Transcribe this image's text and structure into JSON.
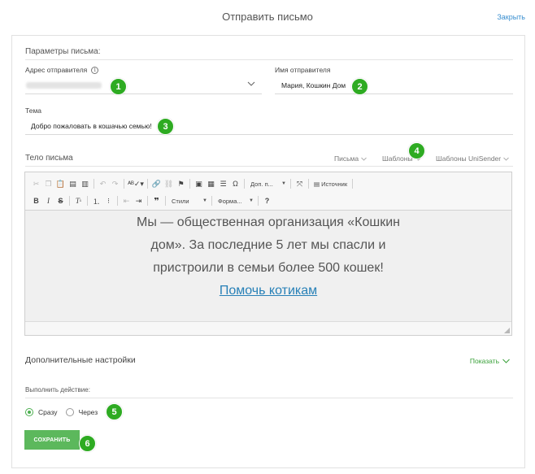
{
  "header": {
    "title": "Отправить письмо",
    "close_label": "Закрыть"
  },
  "params": {
    "section_title": "Параметры письма:",
    "sender_address_label": "Адрес отправителя",
    "info_icon_glyph": "i",
    "sender_name_label": "Имя отправителя",
    "sender_name_value": "Мария, Кошкин Дом",
    "subject_label": "Тема",
    "subject_value": "Добро пожаловать в кошачью семью!"
  },
  "body_section": {
    "title": "Тело письма",
    "tabs": [
      {
        "label": "Письма"
      },
      {
        "label": "Шаблоны"
      },
      {
        "label": "Шаблоны UniSender"
      }
    ]
  },
  "toolbar": {
    "row1_combo": "Доп. п...",
    "source_label": "Источник",
    "styles_combo": "Стили",
    "format_combo": "Форма...",
    "help_glyph": "?"
  },
  "content": {
    "line1": "Мы — общественная организация «Кошкин",
    "line2": "дом». За последние 5 лет мы спасли и",
    "line3": "пристроили в семьи более 500 кошек!",
    "link": "Помочь котикам"
  },
  "advanced": {
    "title": "Дополнительные настройки",
    "show_label": "Показать"
  },
  "action": {
    "label": "Выполнить действие:",
    "options": [
      {
        "label": "Сразу",
        "checked": true
      },
      {
        "label": "Через",
        "checked": false
      }
    ]
  },
  "save_label": "СОХРАНИТЬ",
  "badges": [
    "1",
    "2",
    "3",
    "4",
    "5",
    "6"
  ],
  "colors": {
    "accent_green": "#5cb85c",
    "badge_green": "#2eab22",
    "link_blue": "#2780b7"
  }
}
